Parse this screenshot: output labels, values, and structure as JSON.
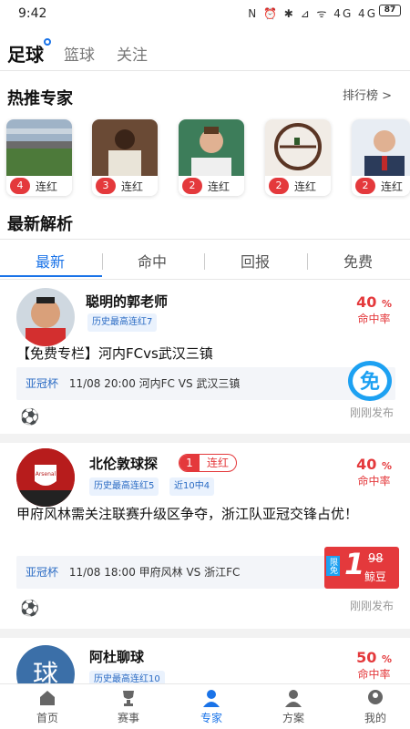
{
  "status": {
    "time": "9:42",
    "icons": "N ⏰ ✱ ⊿ ᯤ 4G 4G",
    "battery": "87"
  },
  "sport_tabs": [
    "足球",
    "篮球",
    "关注"
  ],
  "hot": {
    "title": "热推专家",
    "rank_link": "排行榜 >",
    "experts": [
      {
        "num": "4",
        "label": "连红"
      },
      {
        "num": "3",
        "label": "连红"
      },
      {
        "num": "2",
        "label": "连红"
      },
      {
        "num": "2",
        "label": "连红"
      },
      {
        "num": "2",
        "label": "连红"
      }
    ]
  },
  "latest": {
    "title": "最新解析",
    "tabs": [
      "最新",
      "命中",
      "回报",
      "免费"
    ]
  },
  "cards": [
    {
      "name": "聪明的郭老师",
      "badges": [
        "历史最高连红7"
      ],
      "rate": "40",
      "rate_unit": "%",
      "rate_label": "命中率",
      "title": "【免费专栏】河内FCvs武汉三镇",
      "league": "亚冠杯",
      "match": "11/08 20:00  河内FC VS 武汉三镇",
      "tag": "免",
      "published": "刚刚发布"
    },
    {
      "name": "北伦敦球探",
      "streak_num": "1",
      "streak_label": "连红",
      "badges": [
        "历史最高连红5",
        "近10中4"
      ],
      "rate": "40",
      "rate_unit": "%",
      "rate_label": "命中率",
      "title": "甲府风林需关注联赛升级区争夺，浙江队亚冠交锋占优！",
      "league": "亚冠杯",
      "match": "11/08 18:00  甲府风林 VS 浙江FC",
      "price_tag": "限免",
      "price_new": "1",
      "price_old": "98",
      "price_unit": "鲸豆",
      "published": "刚刚发布"
    },
    {
      "name": "阿杜聊球",
      "avatar_char": "球",
      "badges": [
        "历史最高连红10"
      ],
      "rate": "50",
      "rate_unit": "%",
      "rate_label": "命中率"
    }
  ],
  "nav": [
    "首页",
    "赛事",
    "专家",
    "方案",
    "我的"
  ],
  "colors": {
    "accent": "#1a73e8",
    "red": "#e4393c"
  }
}
